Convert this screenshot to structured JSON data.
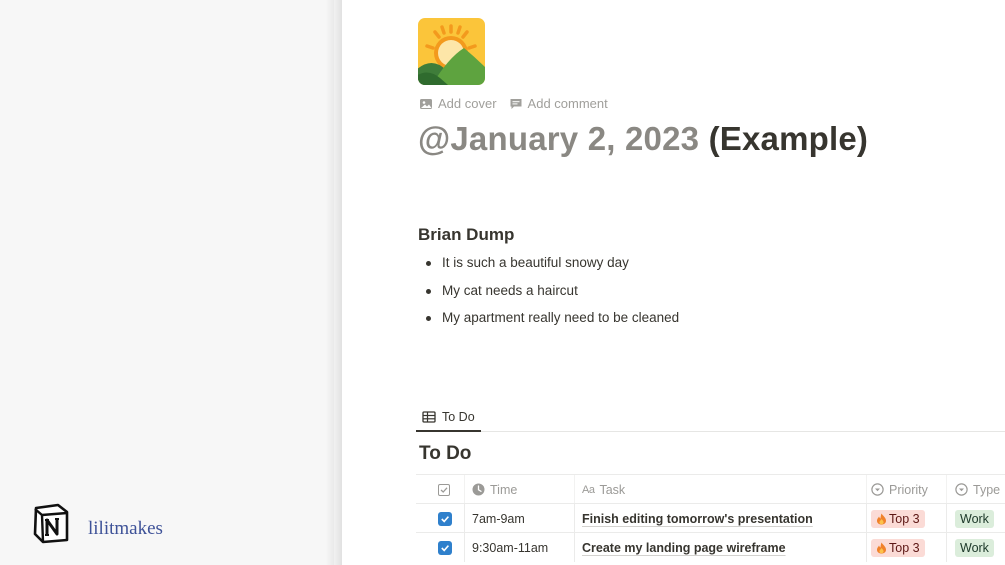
{
  "brand": {
    "logo_icon": "notion-logo-icon",
    "name": "lilitmakes",
    "color": "#3e5298"
  },
  "page": {
    "icon": "sunrise-mountains-icon",
    "add_cover": "Add cover",
    "add_comment": "Add comment",
    "title_mention": "@January 2, 2023",
    "title_suffix": "(Example)"
  },
  "brain_dump": {
    "heading": "Brian Dump",
    "items": [
      "It is such a beautiful snowy day",
      "My cat needs a haircut",
      "My apartment really need to be cleaned"
    ]
  },
  "database": {
    "tab_label": "To Do",
    "title": "To Do",
    "columns": {
      "time": "Time",
      "task_prefix": "Aa",
      "task": "Task",
      "priority": "Priority",
      "type": "Type"
    },
    "rows": [
      {
        "done": true,
        "time": "7am-9am",
        "task": "Finish editing tomorrow's presentation",
        "priority": "Top 3",
        "type": "Work"
      },
      {
        "done": true,
        "time": "9:30am-11am",
        "task": "Create my landing page wireframe",
        "priority": "Top 3",
        "type": "Work"
      }
    ]
  },
  "colors": {
    "checkbox": "#2f80cc",
    "priority_tag_bg": "#fbdbd6",
    "type_tag_bg": "#dbeddb",
    "left_panel": "#f7f7f7"
  }
}
